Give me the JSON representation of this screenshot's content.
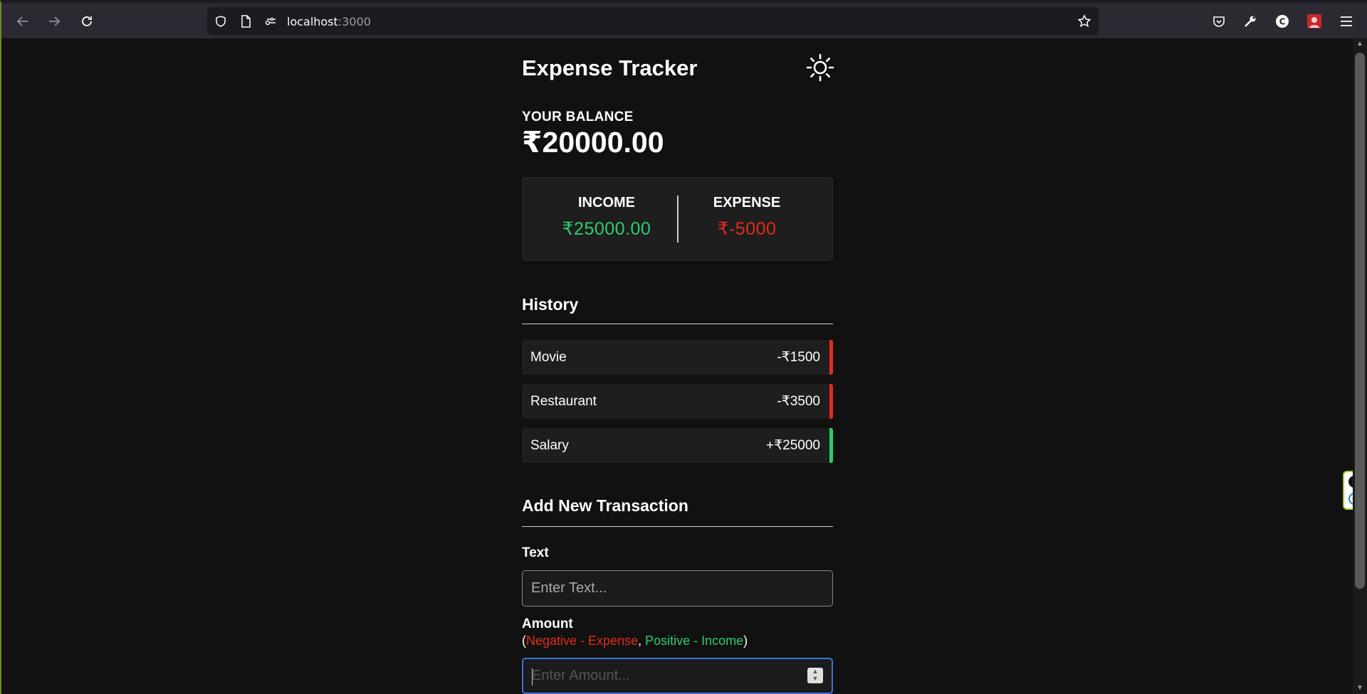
{
  "browser": {
    "url_host": "localhost",
    "url_port": ":3000"
  },
  "app": {
    "title": "Expense Tracker"
  },
  "balance": {
    "label": "YOUR BALANCE",
    "value": "₹20000.00"
  },
  "summary": {
    "income_label": "INCOME",
    "income_value": "₹25000.00",
    "expense_label": "EXPENSE",
    "expense_value": "₹-5000"
  },
  "history": {
    "title": "History",
    "items": [
      {
        "text": "Movie",
        "amount": "-₹1500",
        "type": "minus"
      },
      {
        "text": "Restaurant",
        "amount": "-₹3500",
        "type": "minus"
      },
      {
        "text": "Salary",
        "amount": "+₹25000",
        "type": "plus"
      }
    ]
  },
  "form": {
    "title": "Add New Transaction",
    "text_label": "Text",
    "text_placeholder": "Enter Text...",
    "amount_label": "Amount",
    "hint_open": "(",
    "hint_negative": "Negative - Expense",
    "hint_comma": ", ",
    "hint_positive": "Positive - Income",
    "hint_close": ")",
    "amount_placeholder": "Enter Amount..."
  },
  "colors": {
    "income": "#2ecc71",
    "expense": "#e32b1d",
    "background": "#111111",
    "card": "#1e1e1e",
    "focus": "#3d74d8"
  },
  "icons": [
    "back-icon",
    "forward-icon",
    "reload-icon",
    "shield-icon",
    "page-icon",
    "permissions-icon",
    "bookmark-star-icon",
    "pocket-icon",
    "wrench-icon",
    "extension-c-icon",
    "extension-avatar-icon",
    "menu-icon",
    "sun-icon"
  ]
}
